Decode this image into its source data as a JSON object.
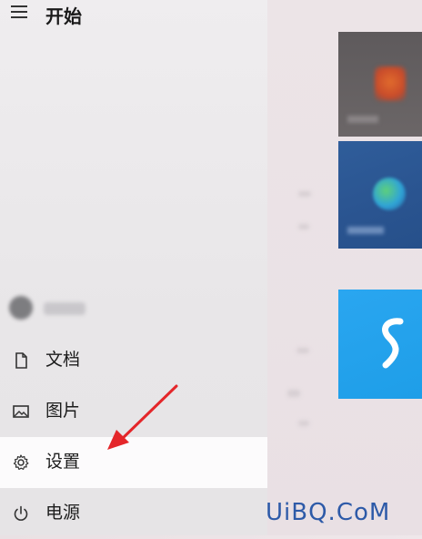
{
  "start_menu": {
    "title": "开始",
    "items": [
      {
        "label": "文档",
        "icon": "document-icon"
      },
      {
        "label": "图片",
        "icon": "picture-icon"
      },
      {
        "label": "设置",
        "icon": "gear-icon",
        "highlighted": true
      },
      {
        "label": "电源",
        "icon": "power-icon"
      }
    ]
  },
  "watermark": "UiBQ.CoM",
  "colors": {
    "arrow": "#e4262a",
    "tile_dark": "#5e5a5c",
    "tile_blue": "#2f5d9a",
    "tile_cyan": "#2aa6f0",
    "watermark": "#2d5aa8"
  }
}
